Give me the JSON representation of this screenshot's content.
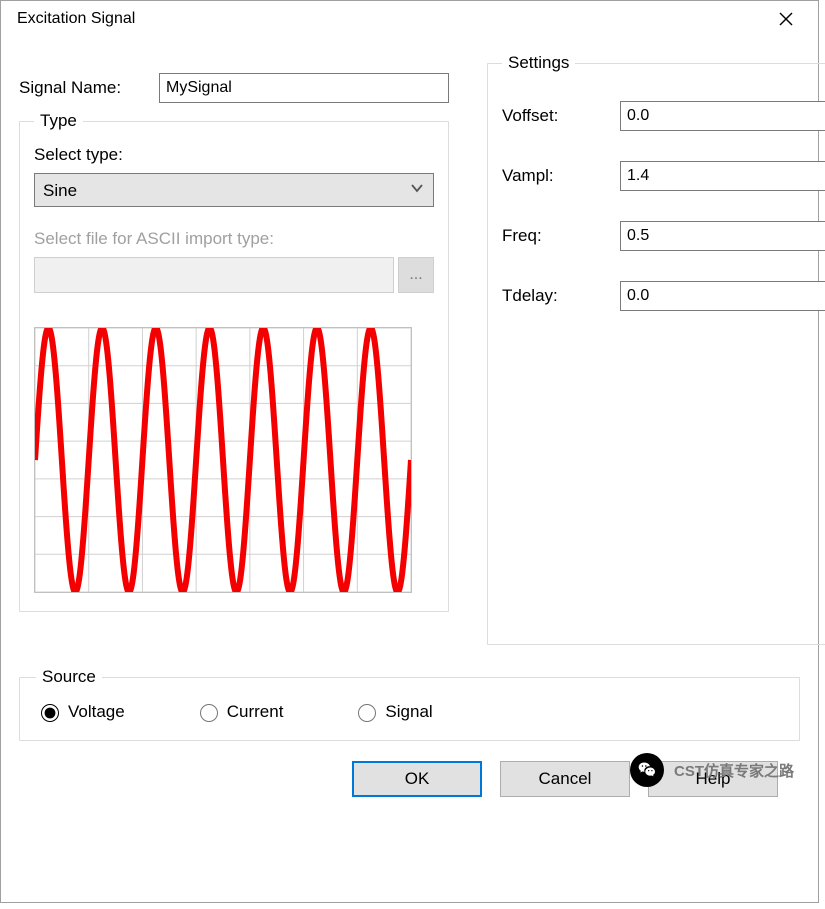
{
  "window": {
    "title": "Excitation Signal"
  },
  "signal_name": {
    "label": "Signal Name:",
    "value": "MySignal"
  },
  "type": {
    "legend": "Type",
    "select_label": "Select type:",
    "selected": "Sine",
    "ascii_label": "Select file for ASCII import type:",
    "ascii_value": "",
    "browse_label": "..."
  },
  "settings": {
    "legend": "Settings",
    "rows": [
      {
        "label": "Voffset:",
        "value": "0.0"
      },
      {
        "label": "Vampl:",
        "value": "1.4"
      },
      {
        "label": "Freq:",
        "value": "0.5"
      },
      {
        "label": "Tdelay:",
        "value": "0.0"
      }
    ]
  },
  "source": {
    "legend": "Source",
    "options": [
      {
        "label": "Voltage",
        "checked": true
      },
      {
        "label": "Current",
        "checked": false
      },
      {
        "label": "Signal",
        "checked": false
      }
    ]
  },
  "buttons": {
    "ok": "OK",
    "cancel": "Cancel",
    "help": "Help"
  },
  "watermark": "CST仿真专家之路",
  "chart_data": {
    "type": "line",
    "title": "",
    "xlabel": "",
    "ylabel": "",
    "xlim": [
      0,
      14
    ],
    "ylim": [
      -1.4,
      1.4
    ],
    "grid": {
      "x_count": 7,
      "y_count": 7
    },
    "series": [
      {
        "name": "sine",
        "color": "#f40000",
        "amplitude": 1.4,
        "frequency": 0.5,
        "offset": 0.0,
        "tdelay": 0.0,
        "samples": 560
      }
    ]
  }
}
